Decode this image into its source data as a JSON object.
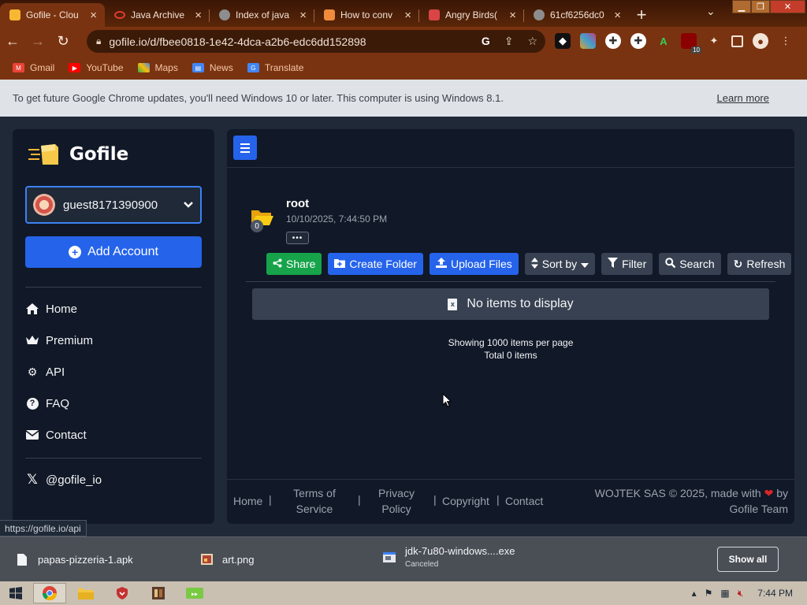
{
  "browser": {
    "tabs": [
      {
        "title": "Gofile - Clou",
        "favicon_color": "#f7b733",
        "active": true
      },
      {
        "title": "Java Archive",
        "favicon_color": "#e23b2e",
        "active": false
      },
      {
        "title": "Index of java",
        "favicon_color": "#9a9a9a",
        "active": false
      },
      {
        "title": "How to conv",
        "favicon_color": "#f08a3c",
        "active": false
      },
      {
        "title": "Angry Birds(",
        "favicon_color": "#d94545",
        "active": false
      },
      {
        "title": "61cf6256dc0",
        "favicon_color": "#9a9a9a",
        "active": false
      }
    ],
    "new_tab_symbol": "+",
    "address": "gofile.io/d/fbee0818-1e42-4dca-a2b6-edc6dd152898",
    "bookmarks": [
      {
        "label": "Gmail",
        "icon": "gmail-icon",
        "color": "#ea4335"
      },
      {
        "label": "YouTube",
        "icon": "youtube-icon",
        "color": "#ff0000"
      },
      {
        "label": "Maps",
        "icon": "maps-icon",
        "color": "#34a853"
      },
      {
        "label": "News",
        "icon": "news-icon",
        "color": "#4285f4"
      },
      {
        "label": "Translate",
        "icon": "translate-icon",
        "color": "#4285f4"
      }
    ],
    "extension_badge": "10",
    "infobar": {
      "message": "To get future Google Chrome updates, you'll need Windows 10 or later. This computer is using Windows 8.1.",
      "link": "Learn more"
    }
  },
  "sidebar": {
    "brand": "Gofile",
    "account": "guest8171390900",
    "add_account": "Add Account",
    "nav": [
      {
        "label": "Home",
        "icon": "home-icon"
      },
      {
        "label": "Premium",
        "icon": "crown-icon"
      },
      {
        "label": "API",
        "icon": "gears-icon"
      },
      {
        "label": "FAQ",
        "icon": "question-icon"
      },
      {
        "label": "Contact",
        "icon": "envelope-icon"
      }
    ],
    "social": "@gofile_io"
  },
  "folder": {
    "name": "root",
    "date": "10/10/2025, 7:44:50 PM",
    "count": "0",
    "more": "•••"
  },
  "actions": [
    {
      "label": "Share",
      "icon": "share-icon",
      "style": "green"
    },
    {
      "label": "Create Folder",
      "icon": "folder-plus-icon",
      "style": "blue"
    },
    {
      "label": "Upload Files",
      "icon": "upload-icon",
      "style": "blue"
    },
    {
      "label": "Sort by",
      "icon": "sort-icon",
      "style": "gray"
    },
    {
      "label": "Filter",
      "icon": "filter-icon",
      "style": "gray"
    },
    {
      "label": "Search",
      "icon": "search-icon",
      "style": "gray"
    },
    {
      "label": "Refresh",
      "icon": "refresh-icon",
      "style": "gray"
    }
  ],
  "empty_message": "No items to display",
  "paging": {
    "per_page": "Showing 1000 items per page",
    "total": "Total 0 items"
  },
  "footer": {
    "home": "Home",
    "terms": "Terms of Service",
    "privacy": "Privacy Policy",
    "copyright": "Copyright",
    "contact": "Contact",
    "credit_prefix": "WOJTEK SAS © 2025, made with",
    "credit_suffix": "by Gofile Team",
    "heart_color": "#dc2626"
  },
  "status_url": "https://gofile.io/api",
  "downloads": [
    {
      "name": "papas-pizzeria-1.apk",
      "status": ""
    },
    {
      "name": "art.png",
      "status": ""
    },
    {
      "name": "jdk-7u80-windows....exe",
      "status": "Canceled"
    }
  ],
  "show_all": "Show all",
  "taskbar": {
    "clock": "7:44 PM"
  }
}
